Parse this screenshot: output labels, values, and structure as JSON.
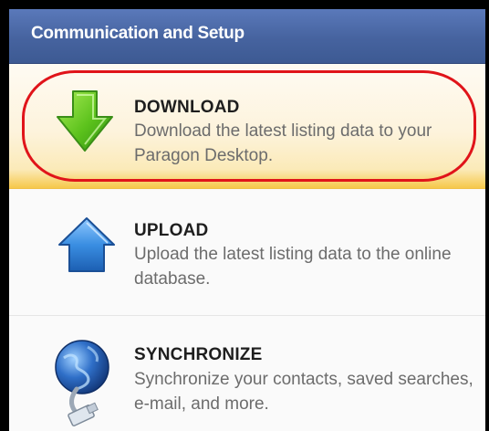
{
  "header": {
    "title": "Communication and Setup"
  },
  "items": [
    {
      "title": "DOWNLOAD",
      "description": "Download the latest listing data to your Paragon Desktop.",
      "icon": "download-arrow-icon",
      "highlighted": true
    },
    {
      "title": "UPLOAD",
      "description": "Upload the latest listing data to the online database.",
      "icon": "upload-house-arrow-icon",
      "highlighted": false
    },
    {
      "title": "SYNCHRONIZE",
      "description": "Synchronize your contacts, saved searches, e-mail, and more.",
      "icon": "globe-network-cable-icon",
      "highlighted": false
    }
  ],
  "colors": {
    "header": "#46639f",
    "highlight_ring": "#e0141a",
    "download_arrow": "#5cc21c",
    "upload_arrow": "#2f7fd6"
  }
}
